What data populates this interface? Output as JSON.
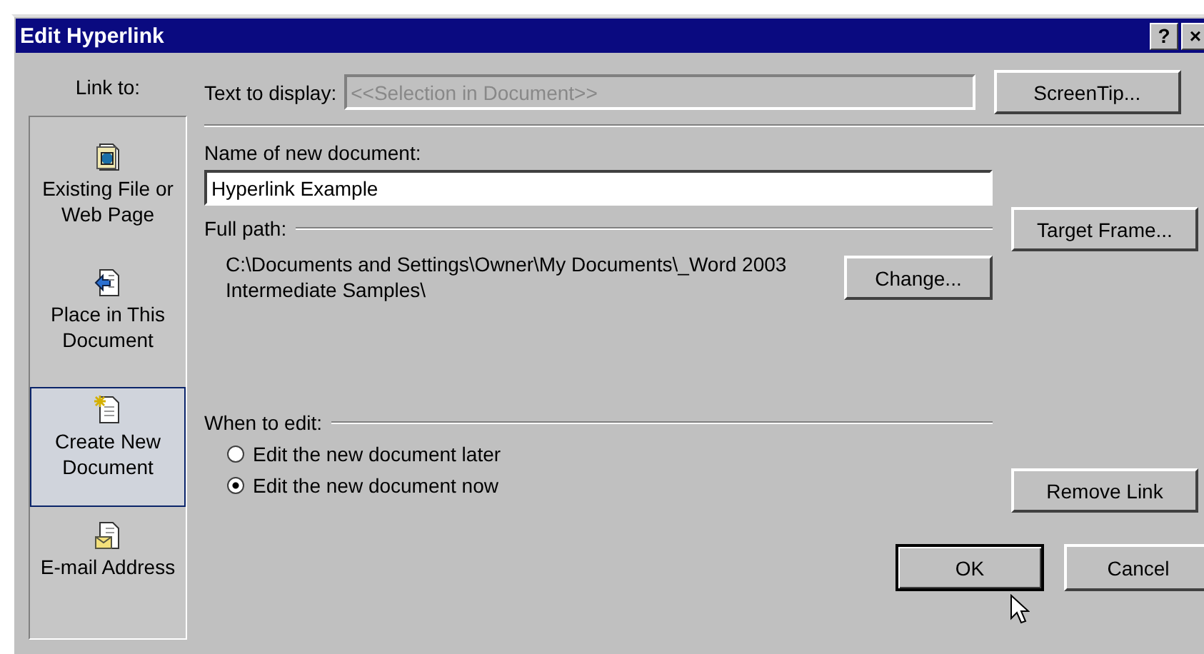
{
  "window": {
    "title": "Edit Hyperlink",
    "title_buttons": [
      "?",
      "×"
    ]
  },
  "link_to": {
    "label": "Link to:",
    "items": [
      {
        "label": "Existing File or Web Page",
        "kind": "file",
        "selected": false
      },
      {
        "label": "Place in This Document",
        "kind": "place",
        "selected": false
      },
      {
        "label": "Create New Document",
        "kind": "new",
        "selected": true
      },
      {
        "label": "E-mail Address",
        "kind": "email",
        "selected": false
      }
    ]
  },
  "text_to_display": {
    "label": "Text to display:",
    "placeholder": "<<Selection in Document>>",
    "disabled": true
  },
  "screentip_button": "ScreenTip...",
  "name_of_new_document": {
    "label": "Name of new document:",
    "value": "Hyperlink Example"
  },
  "full_path": {
    "label": "Full path:",
    "value": "C:\\Documents and Settings\\Owner\\My Documents\\_Word 2003 Intermediate Samples\\"
  },
  "change_button": "Change...",
  "target_frame_button": "Target Frame...",
  "when_to_edit": {
    "label": "When to edit:",
    "options": [
      {
        "label": "Edit the new document later",
        "selected": false
      },
      {
        "label": "Edit the new document now",
        "selected": true
      }
    ]
  },
  "remove_link_button": "Remove Link",
  "buttons": [
    {
      "label": "OK",
      "default": true
    },
    {
      "label": "Cancel",
      "default": false
    }
  ]
}
